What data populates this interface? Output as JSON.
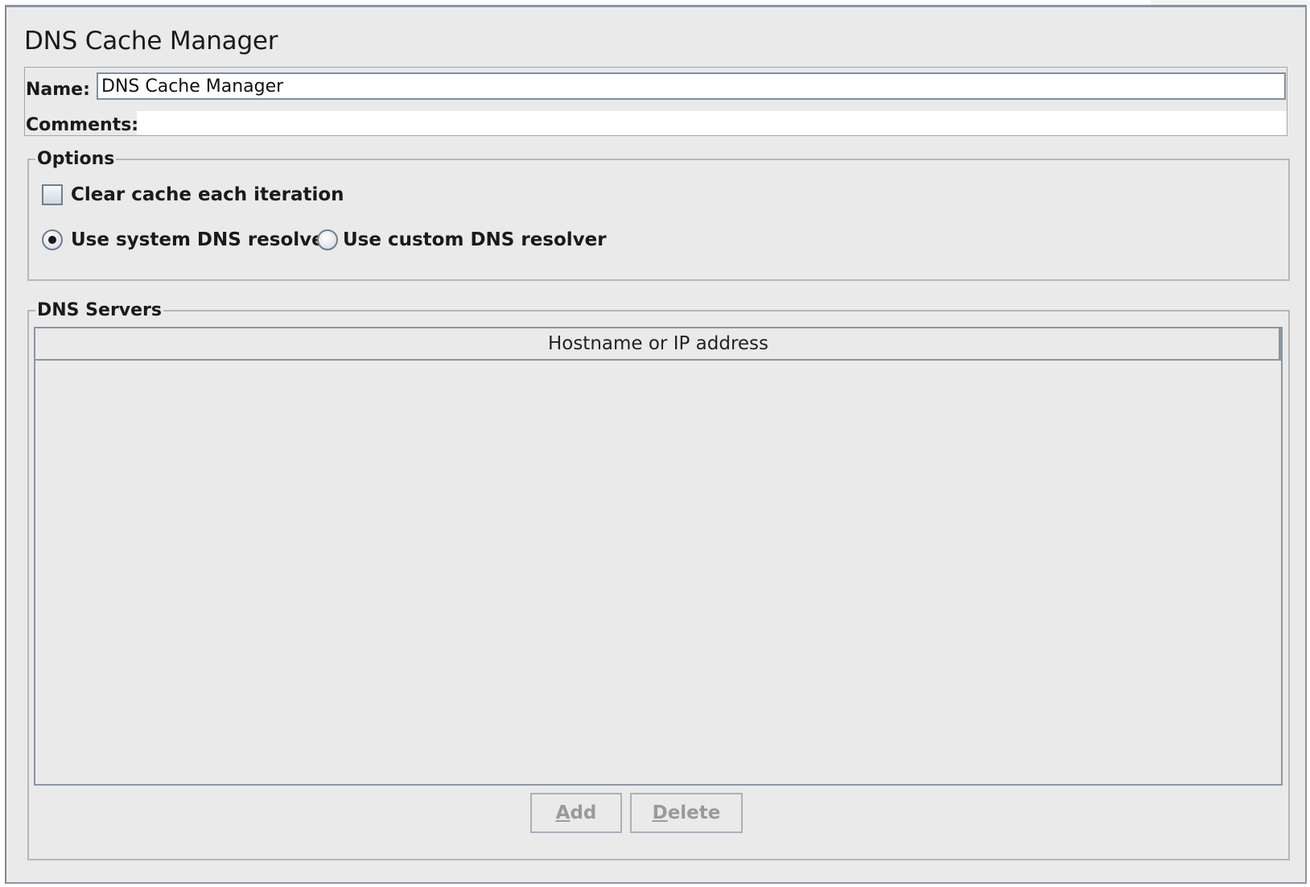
{
  "panel": {
    "title": "DNS Cache Manager"
  },
  "name_field": {
    "label": "Name:",
    "value": "DNS Cache Manager"
  },
  "comments_field": {
    "label": "Comments:",
    "value": ""
  },
  "options": {
    "title": "Options",
    "clear_cache": {
      "label": "Clear cache each iteration",
      "checked": false
    },
    "resolver": {
      "system_label": "Use system DNS resolver",
      "custom_label": "Use custom DNS resolver",
      "selected": "system"
    }
  },
  "dns_servers": {
    "title": "DNS Servers",
    "table": {
      "columns": [
        "Hostname or IP address"
      ],
      "rows": []
    },
    "buttons": {
      "add": {
        "mnemonic": "A",
        "rest": "dd",
        "enabled": false
      },
      "delete": {
        "mnemonic": "D",
        "rest": "elete",
        "enabled": false
      }
    }
  }
}
